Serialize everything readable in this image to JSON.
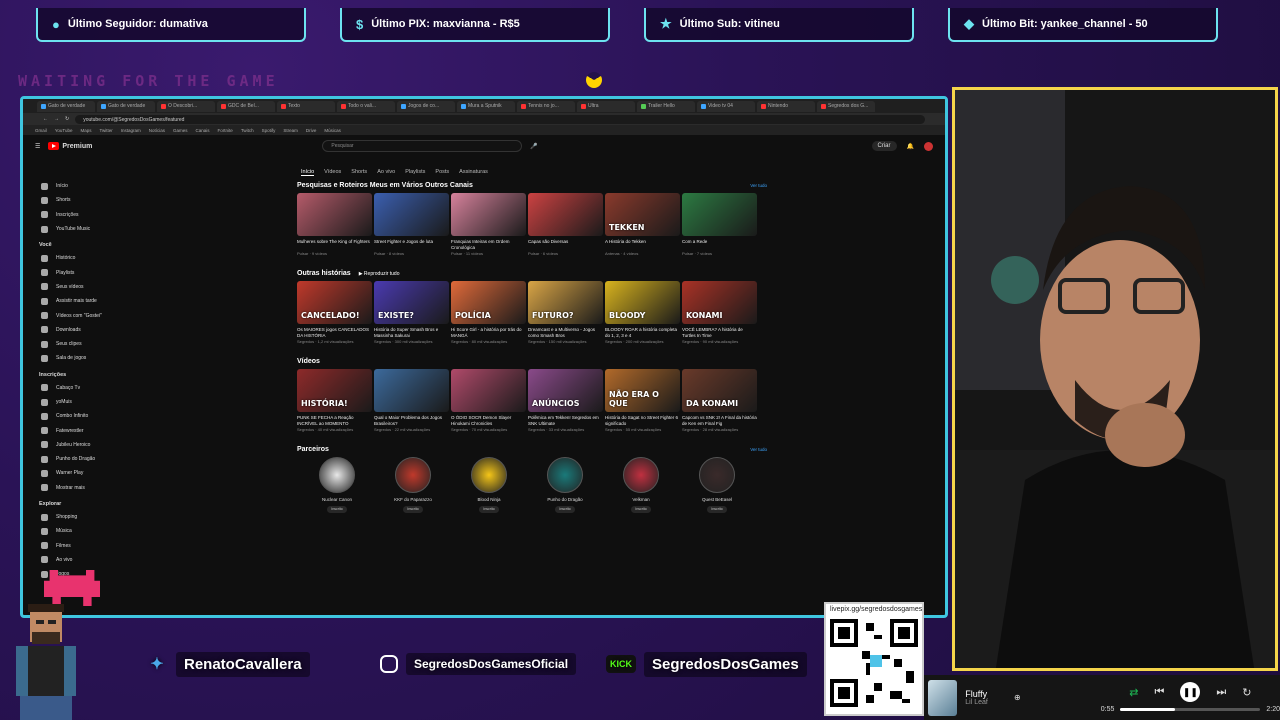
{
  "alerts": [
    {
      "icon": "user-icon",
      "text": "Último Seguidor: dumativa"
    },
    {
      "icon": "dollar-icon",
      "text": "Último PIX: maxvianna - R$5"
    },
    {
      "icon": "star-icon",
      "text": "Último Sub: vitineu"
    },
    {
      "icon": "diamond-icon",
      "text": "Último Bit: yankee_channel - 50"
    }
  ],
  "waiting": "WAITING FOR THE GAME",
  "browser": {
    "tabs": [
      "Gato de verdade",
      "Gato de verdade",
      "O Descobri...",
      "GDC de Bel...",
      "Texto",
      "Todo o vali...",
      "Jogos de co...",
      "Mura a Sputnik",
      "Tennis no jo...",
      "Ultra",
      "Trailer Hello",
      "Video tv 04",
      "Nintendo",
      "Segredos dos G..."
    ],
    "url": "youtube.com/@SegredosDosGames/featured",
    "bookmarks": [
      "Gmail",
      "YouTube",
      "Maps",
      "Twitter",
      "Instagram",
      "Notícias",
      "Games",
      "Canais",
      "Fortnite",
      "Twitch",
      "Spotify",
      "Stream",
      "Drive",
      "Músicas"
    ]
  },
  "yt": {
    "logo": "Premium",
    "search_placeholder": "Pesquisar",
    "create": "Criar",
    "sidebar_main": [
      "Início",
      "Shorts",
      "Inscrições",
      "YouTube Music"
    ],
    "you_header": "Você",
    "sidebar_you": [
      "Histórico",
      "Playlists",
      "Seus vídeos",
      "Assistir mais tarde",
      "Vídeos com \"Gostei\"",
      "Downloads",
      "Seus clipes",
      "Sala de jogos"
    ],
    "subs_header": "Inscrições",
    "sidebar_subs": [
      "Cabaço Tv",
      "yoMuis",
      "Combo Infinito",
      "Fatewrestler",
      "Jubileu Heroico",
      "Punho do Dragão",
      "Warner Play",
      "Mostrar mais"
    ],
    "explore_header": "Explorar",
    "sidebar_explore": [
      "Shopping",
      "Música",
      "Filmes",
      "Ao vivo",
      "Jogos"
    ],
    "channel_tabs": [
      "Início",
      "Vídeos",
      "Shorts",
      "Ao vivo",
      "Playlists",
      "Posts",
      "Assinaturas"
    ],
    "section1": {
      "title": "Pesquisas e Roteiros Meus em Vários Outros Canais",
      "more": "Ver tudo"
    },
    "section2": {
      "title": "Outras histórias",
      "play": "Reproduzir tudo"
    },
    "section3": {
      "title": "Vídeos"
    },
    "section4": {
      "title": "Parceiros",
      "more": "Ver tudo"
    },
    "row1": [
      {
        "title": "Mulheres sobre The King of Fighters",
        "meta": "Pulsar · 9 vídeos",
        "color": "#b55b6a",
        "txt": ""
      },
      {
        "title": "Street Fighter e Jogos de luta",
        "meta": "Pulsar · 8 vídeos",
        "color": "#3b5fb0",
        "txt": ""
      },
      {
        "title": "Franquias Inteiras em Ordem Cronológica",
        "meta": "Pulsar · 11 vídeos",
        "color": "#d7829c",
        "txt": ""
      },
      {
        "title": "Capas são Diversas",
        "meta": "Pulsar · 6 vídeos",
        "color": "#cc4242",
        "txt": ""
      },
      {
        "title": "A História do Tekken",
        "meta": "Antenas · 4 vídeos",
        "color": "#8a3a2c",
        "txt": "TEKKEN"
      },
      {
        "title": "Com a Rede",
        "meta": "Pulsar · 7 vídeos",
        "color": "#2c7a42",
        "txt": ""
      }
    ],
    "row2": [
      {
        "title": "Os MAIORES jogos CANCELADOS DA HISTÓRIA",
        "meta": "Segredos · 1,2 mi visualizações",
        "color": "#c0392b",
        "txt": "CANCELADO!"
      },
      {
        "title": "História do Super Smash Bros e Massinha Sakurai",
        "meta": "Segredos · 300 mil visualizações",
        "color": "#4a3ab0",
        "txt": "EXISTE?"
      },
      {
        "title": "Hi Score Girl - a história por trás do MANGÁ",
        "meta": "Segredos · 80 mil visualizações",
        "color": "#e06a3a",
        "txt": "POLÍCIA"
      },
      {
        "title": "Dreamcast e a Multiverso - Jogos como Smash Bros",
        "meta": "Segredos · 150 mil visualizações",
        "color": "#d9a546",
        "txt": "FUTURO?"
      },
      {
        "title": "BLOODY ROAR a história completa do 1, 2, 3 e 4",
        "meta": "Segredos · 200 mil visualizações",
        "color": "#d8b31e",
        "txt": "BLOODY"
      },
      {
        "title": "VOCÊ LEMBRA? A história de Turtles In Time",
        "meta": "Segredos · 90 mil visualizações",
        "color": "#a93226",
        "txt": "KONAMI"
      }
    ],
    "row3": [
      {
        "title": "PUNK SE FECHA a Reação INCRÍVEL ao MOMENTO",
        "meta": "Segredos · 40 mil visualizações",
        "color": "#8e2a2a",
        "txt": "HISTÓRIA!"
      },
      {
        "title": "Qual o Maior Problema dos Jogos Brasileiros?",
        "meta": "Segredos · 22 mil visualizações",
        "color": "#3c6a9c",
        "txt": ""
      },
      {
        "title": "O ÓDIO SOCR Demon Slayer Hinokami Chronicles",
        "meta": "Segredos · 70 mil visualizações",
        "color": "#b04a6a",
        "txt": ""
      },
      {
        "title": "Polêmica em Tekken! Segredos em SNK Ultimate",
        "meta": "Segredos · 33 mil visualizações",
        "color": "#8a4a8a",
        "txt": "ANÚNCIOS"
      },
      {
        "title": "História do Sagat no Street Fighter 6 significado",
        "meta": "Segredos · 55 mil visualizações",
        "color": "#b26a2a",
        "txt": "NÃO ERA O QUE"
      },
      {
        "title": "Capcom vs SNK 2! A Final da história de Ken em Final Fig",
        "meta": "Segredos · 28 mil visualizações",
        "color": "#6a3a2a",
        "txt": "DA KONAMI"
      }
    ],
    "partners": [
      {
        "name": "Nuclear Canon",
        "color": "#e8e8e8"
      },
      {
        "name": "KKF do Paparazzo",
        "color": "#c0392b"
      },
      {
        "name": "Blood Ninja",
        "color": "#f4c518"
      },
      {
        "name": "Punho do Dragão",
        "color": "#1a7a7a"
      },
      {
        "name": "Velkman",
        "color": "#c03040"
      },
      {
        "name": "Quest BeEasel",
        "color": "#3a2a2a"
      }
    ],
    "subscribe": "Inscrito"
  },
  "social": {
    "twitter": "RenatoCavallera",
    "instagram": "SegredosDosGamesOficial",
    "kick_badge": "KICK",
    "kick": "SegredosDosGames"
  },
  "qr": {
    "url": "livepix.gg/segredosdosgames"
  },
  "player": {
    "track": "Fluffy",
    "artist": "Lil Leaf",
    "elapsed": "0:55",
    "total": "2:20",
    "progress": 0.39
  },
  "colors": {
    "frame": "#3fc6e0",
    "cam_border": "#f5d54a",
    "accent_pink": "#e8336e"
  }
}
